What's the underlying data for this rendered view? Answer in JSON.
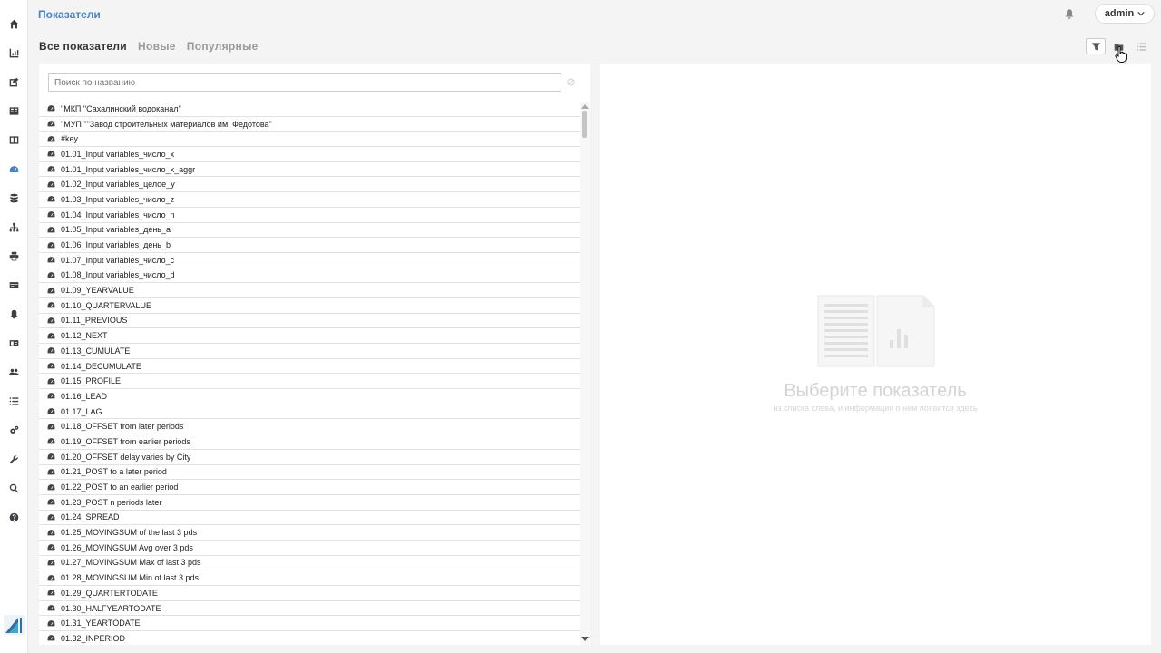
{
  "header": {
    "title": "Показатели",
    "user": "admin"
  },
  "tabs": [
    {
      "label": "Все показатели",
      "active": true
    },
    {
      "label": "Новые",
      "active": false
    },
    {
      "label": "Популярные",
      "active": false
    }
  ],
  "sidebar": {
    "icons": [
      "home-icon",
      "bar-chart-icon",
      "edit-icon",
      "table-icon",
      "columns-icon",
      "dashboard-icon",
      "database-icon",
      "sitemap-icon",
      "print-icon",
      "card-icon",
      "bell-icon",
      "id-card-icon",
      "users-icon",
      "list-icon",
      "cogs-icon",
      "wrench-icon",
      "search-icon",
      "help-icon"
    ],
    "active": "dashboard-icon"
  },
  "search": {
    "placeholder": "Поиск по названию"
  },
  "list": [
    "\"МКП \"Сахалинский водоканал\"",
    "\"МУП \"\"Завод строительных материалов им. Федотова\"",
    "#key",
    "01.01_Input variables_число_x",
    "01.01_Input variables_число_x_aggr",
    "01.02_Input variables_целое_y",
    "01.03_Input variables_число_z",
    "01.04_Input variables_число_n",
    "01.05_Input variables_день_a",
    "01.06_Input variables_день_b",
    "01.07_Input variables_число_c",
    "01.08_Input variables_число_d",
    "01.09_YEARVALUE",
    "01.10_QUARTERVALUE",
    "01.11_PREVIOUS",
    "01.12_NEXT",
    "01.13_CUMULATE",
    "01.14_DECUMULATE",
    "01.15_PROFILE",
    "01.16_LEAD",
    "01.17_LAG",
    "01.18_OFFSET from later periods",
    "01.19_OFFSET from earlier periods",
    "01.20_OFFSET delay varies by City",
    "01.21_POST to a later period",
    "01.22_POST to an earlier period",
    "01.23_POST n periods later",
    "01.24_SPREAD",
    "01.25_MOVINGSUM of the last 3 pds",
    "01.26_MOVINGSUM Avg over 3 pds",
    "01.27_MOVINGSUM Max of last 3 pds",
    "01.28_MOVINGSUM Min of last 3 pds",
    "01.29_QUARTERTODATE",
    "01.30_HALFYEARTODATE",
    "01.31_YEARTODATE",
    "01.32_INPERIOD"
  ],
  "empty_state": {
    "title": "Выберите показатель",
    "subtitle": "из списка слева, и информация о нем появится здесь"
  }
}
